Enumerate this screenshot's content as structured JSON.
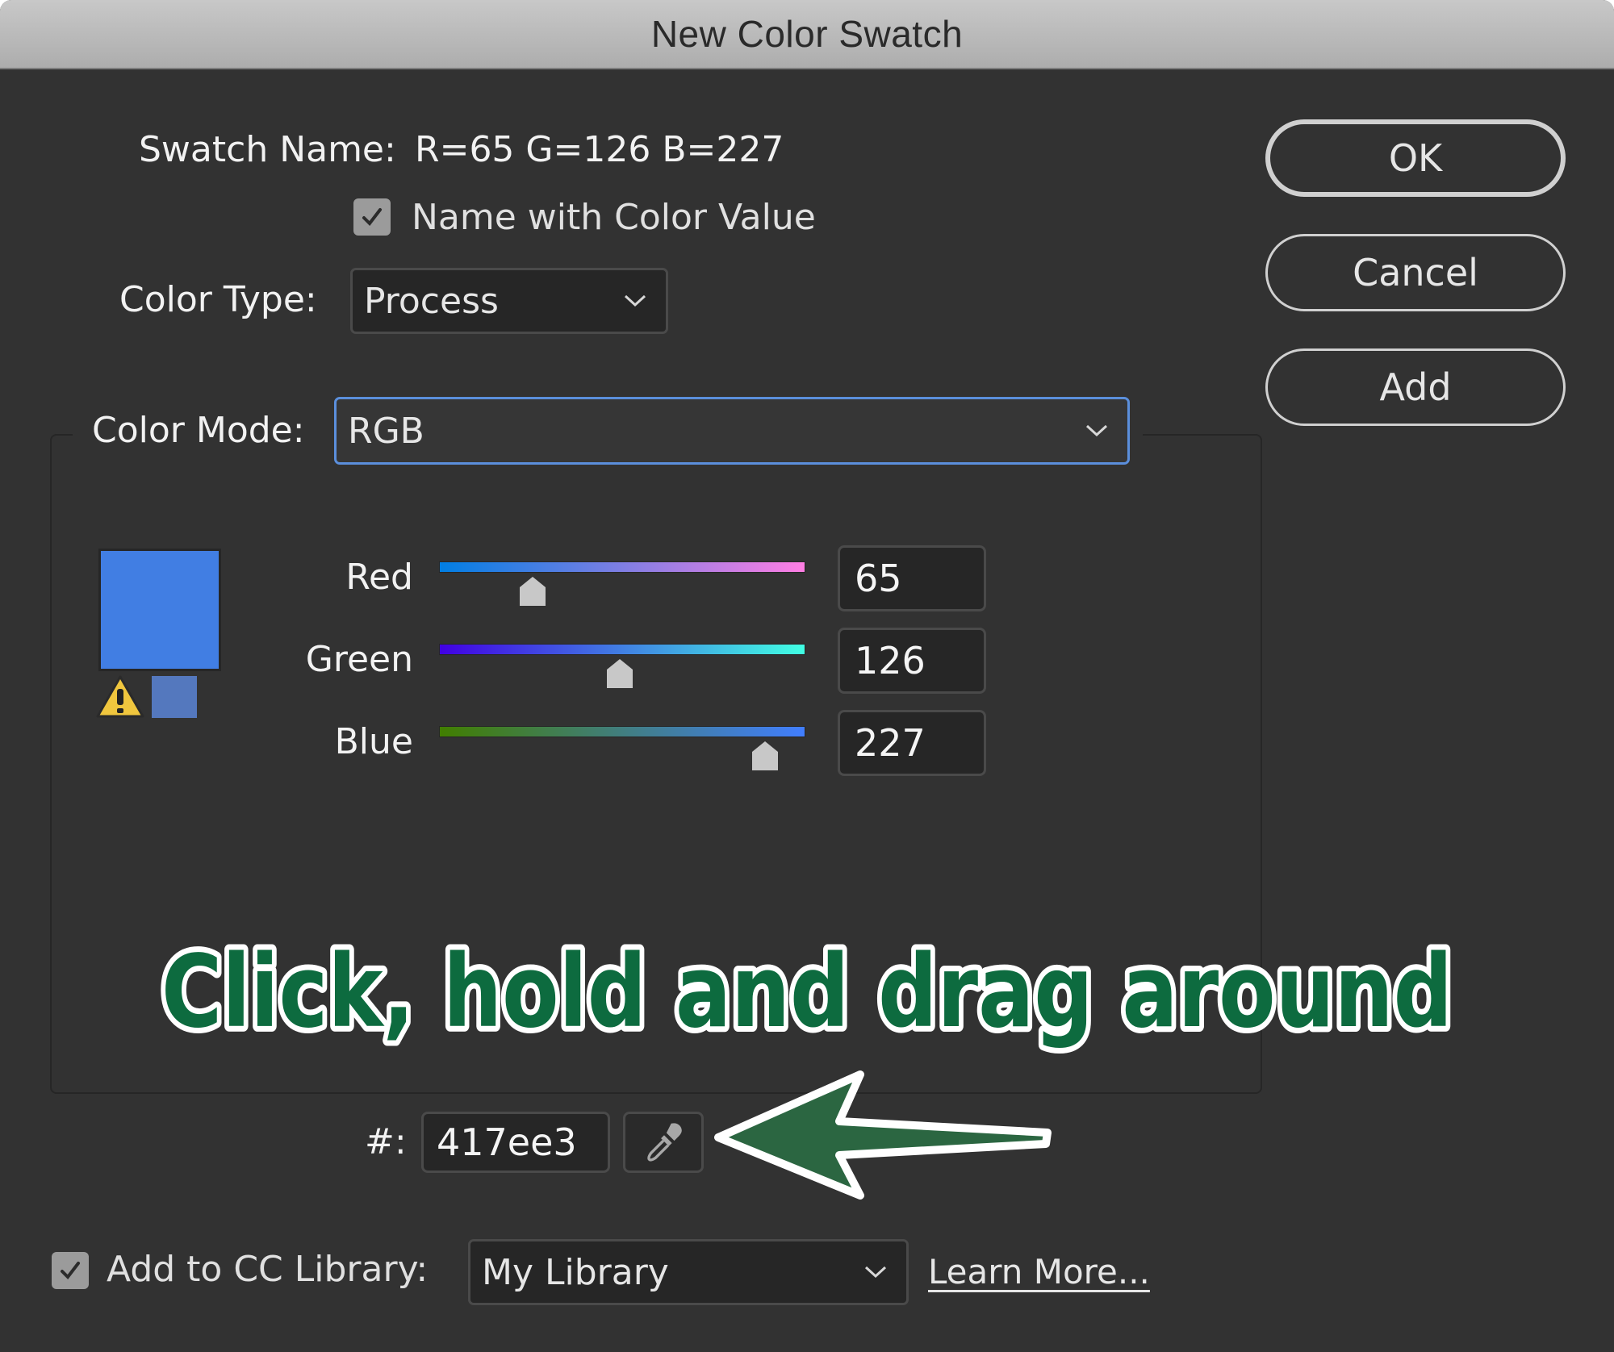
{
  "window": {
    "title": "New Color Swatch"
  },
  "swatch": {
    "name_label": "Swatch Name:",
    "name_value": "R=65 G=126 B=227",
    "name_with_color_value_label": "Name with Color Value",
    "name_with_color_value_checked": true
  },
  "color_type": {
    "label": "Color Type:",
    "selected": "Process"
  },
  "color_mode": {
    "label": "Color Mode:",
    "selected": "RGB"
  },
  "preview": {
    "color": "#417ee3",
    "out_of_gamut_color": "#5478be",
    "warning_icon": "gamut-warning-icon"
  },
  "channels": [
    {
      "label": "Red",
      "value": "65",
      "fraction": 0.255,
      "gradient_start": "#007ee3",
      "gradient_end": "#ff7ee3"
    },
    {
      "label": "Green",
      "value": "126",
      "fraction": 0.494,
      "gradient_start": "#4100e3",
      "gradient_end": "#41ffe3"
    },
    {
      "label": "Blue",
      "value": "227",
      "fraction": 0.89,
      "gradient_start": "#417e00",
      "gradient_end": "#417eff"
    }
  ],
  "hex": {
    "label": "#:",
    "value": "417ee3",
    "eyedropper_icon": "eyedropper-icon"
  },
  "buttons": {
    "ok": "OK",
    "cancel": "Cancel",
    "add": "Add"
  },
  "library": {
    "checkbox_label": "Add to CC Library:",
    "checked": true,
    "selected": "My Library",
    "learn_more": "Learn More..."
  },
  "annotation": {
    "text": "Click, hold and drag around",
    "color": "#0d6b3f",
    "arrow_color": "#2b6641"
  }
}
